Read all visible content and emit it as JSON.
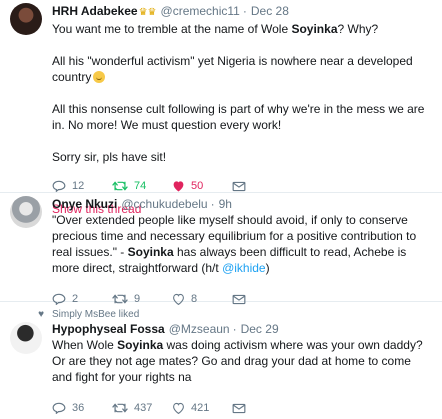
{
  "tweets": [
    {
      "name": "HRH Adabekee",
      "badge_icon": "crown-icon",
      "handle": "@cremechic11",
      "separator": "·",
      "time": "Dec 28",
      "lines": {
        "l1a": "You want me to tremble at the name of Wole ",
        "l1b": "Soyinka",
        "l1c": "? Why?",
        "l2": "All his \"wonderful activism\" yet Nigeria is nowhere near a developed country",
        "l2_emoji": "grinning-face-emoji",
        "l3": "All this nonsense cult following is part of why we're in the mess we are in. No more! We must question every work!",
        "l4": "Sorry sir, pls have sit!"
      },
      "replies": "12",
      "retweets": "74",
      "likes": "50",
      "show_thread": "Show this thread"
    },
    {
      "name": "Onye Nkuzi",
      "handle": "@cchukudebelu",
      "separator": "·",
      "time": "9h",
      "lines": {
        "a": "\"Over extended people like myself should avoid, if only to conserve precious time and necessary equilibrium for a positive contribution to real issues.\" - ",
        "b": "Soyinka",
        "c": " has always been difficult to read, Achebe is more direct, straightforward (h/t ",
        "d": "@ikhide",
        "e": ")"
      },
      "replies": "2",
      "retweets": "9",
      "likes": "8"
    },
    {
      "social_context": "Simply MsBee liked",
      "name": "Hypophyseal Fossa",
      "handle": "@Mzseaun",
      "separator": "·",
      "time": "Dec 29",
      "lines": {
        "a": "When Wole ",
        "b": "Soyinka",
        "c": " was doing activism where was your own daddy? Or are they not age mates? Go and drag your dad at home to come and fight for your rights na"
      },
      "replies": "36",
      "retweets": "437",
      "likes": "421"
    }
  ],
  "colors": {
    "accent_link": "#1da1f2",
    "retweet_active": "#17bf63",
    "like_active": "#e0245e",
    "muted": "#657786",
    "divider": "#e6ecf0"
  }
}
